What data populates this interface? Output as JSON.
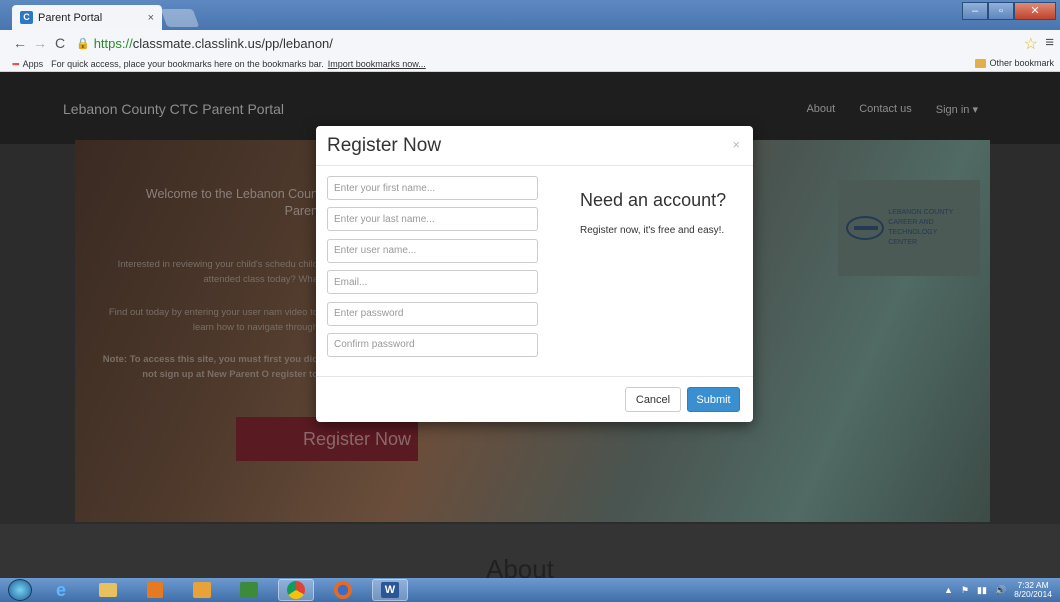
{
  "browser": {
    "tab_title": "Parent Portal",
    "tab_close": "×",
    "url_scheme": "https://",
    "url_host_path": "classmate.classlink.us/pp/lebanon/",
    "bookmarks": {
      "apps_label": "Apps",
      "hint": "For quick access, place your bookmarks here on the bookmarks bar.",
      "import_link": "Import bookmarks now...",
      "other": "Other bookmark"
    }
  },
  "site": {
    "brand": "Lebanon County CTC Parent Portal",
    "nav": {
      "about": "About",
      "contact": "Contact us",
      "signin": "Sign in ▾"
    },
    "hero_title": "Welcome to the Lebanon Coun Paren",
    "hero_p1": "Interested in reviewing your child's schedu child attended class today? Wha",
    "hero_p2": "Find out today by entering your user nam video to learn how to navigate through",
    "hero_note": "Note: To access this site, you must first you did not sign up at New Parent O register to",
    "register_button": "Register Now",
    "about_heading": "About"
  },
  "modal": {
    "title": "Register Now",
    "close": "×",
    "fields": {
      "first_name": "Enter your first name...",
      "last_name": "Enter your last name...",
      "user_name": "Enter user name...",
      "email": "Email...",
      "password": "Enter password",
      "confirm": "Confirm password"
    },
    "side_title": "Need an account?",
    "side_sub": "Register now, it's free and easy!.",
    "cancel": "Cancel",
    "submit": "Submit"
  },
  "taskbar": {
    "word_label": "W",
    "time": "7:32 AM",
    "date": "8/20/2014"
  }
}
